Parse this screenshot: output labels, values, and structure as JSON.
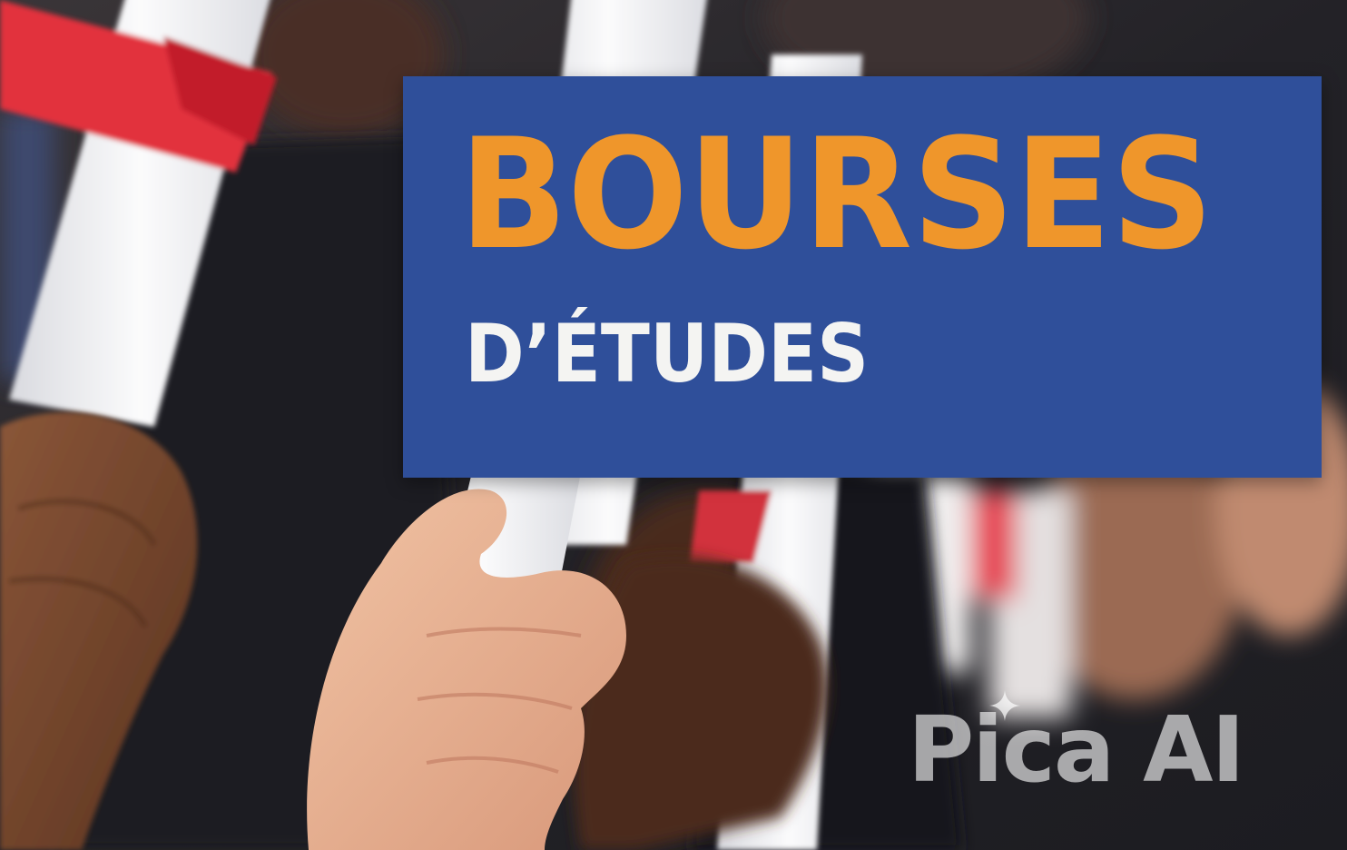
{
  "sign": {
    "title": "BOURSES",
    "subtitle": "D’ÉTUDES"
  },
  "watermark": {
    "text": "Pica AI"
  },
  "colors": {
    "sign_background": "#2f4f9a",
    "title_text": "#ef962b",
    "subtitle_text": "#f4f4f2",
    "ribbon": "#e2313c"
  },
  "icons": [
    "sparkle-icon"
  ]
}
